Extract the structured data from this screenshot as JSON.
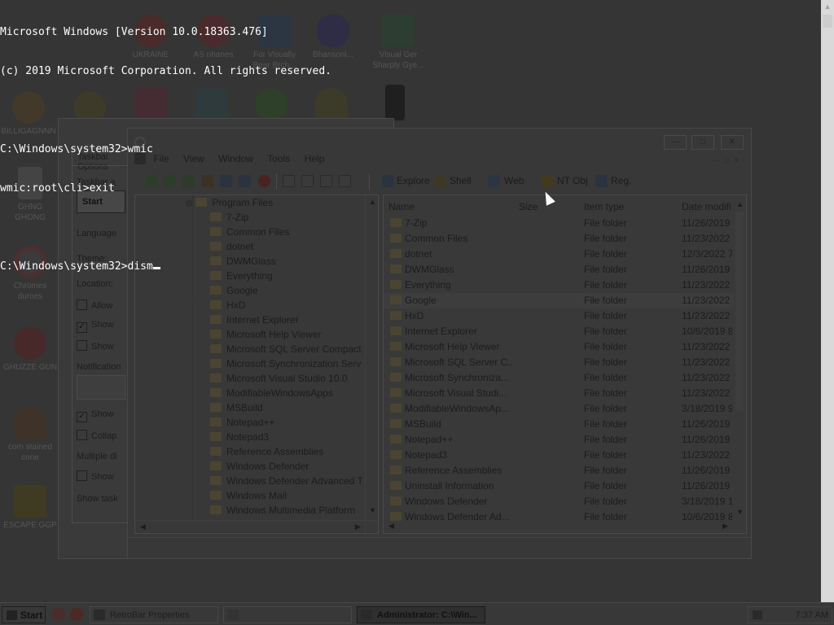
{
  "console": {
    "lines": [
      "Microsoft Windows [Version 10.0.18363.476]",
      "(c) 2019 Microsoft Corporation. All rights reserved.",
      "",
      "C:\\Windows\\system32>wmic",
      "wmic:root\\cli>exit",
      "",
      "C:\\Windows\\system32>dism"
    ]
  },
  "desktop": {
    "icons": [
      {
        "label": "UKRAINE"
      },
      {
        "label": "AS nhanes"
      },
      {
        "label": "For Visually Bear Brch..."
      },
      {
        "label": "Bhansonl..."
      },
      {
        "label": "Visual Ger Sharply Gye..."
      },
      {
        "label": "BILLIGAGNNN"
      },
      {
        "label": "GHNG GHONG"
      },
      {
        "label": "Chromes duroes"
      },
      {
        "label": "GHUZZE GUN"
      },
      {
        "label": "com stained cone"
      },
      {
        "label": "ESCAPE GGP"
      }
    ]
  },
  "properties_dialog": {
    "tab_label": "Taskbar Options",
    "start_preview_label": "Start",
    "rows": [
      "Taskbar a",
      "Language",
      "Theme:",
      "Location:",
      "Allow",
      "Show",
      "Show",
      "Notification",
      "Show",
      "Collap",
      "Multiple di",
      "Show",
      "Show task"
    ]
  },
  "explorer": {
    "menu": [
      "File",
      "View",
      "Window",
      "Tools",
      "Help"
    ],
    "toolbar_buttons": [
      "Explore",
      "Shell",
      "Web",
      "NT Obj",
      "Reg."
    ],
    "tree": {
      "root": "Program Files",
      "items": [
        "7-Zip",
        "Common Files",
        "dotnet",
        "DWMGlass",
        "Everything",
        "Google",
        "HxD",
        "Internet Explorer",
        "Microsoft Help Viewer",
        "Microsoft SQL Server Compact",
        "Microsoft Synchronization Serv",
        "Microsoft Visual Studio 10.0",
        "ModifiableWindowsApps",
        "MSBuild",
        "Notepad++",
        "Notepad3",
        "Reference Assemblies",
        "Windows Defender",
        "Windows Defender Advanced T",
        "Windows Mail",
        "Windows Multimedia Platform"
      ]
    },
    "columns": {
      "name": "Name",
      "size": "Size",
      "type": "Item type",
      "date": "Date modifi"
    },
    "files": [
      {
        "name": "7-Zip",
        "type": "File folder",
        "date": "11/26/2019"
      },
      {
        "name": "Common Files",
        "type": "File folder",
        "date": "11/23/2022"
      },
      {
        "name": "dotnet",
        "type": "File folder",
        "date": "12/3/2022 7"
      },
      {
        "name": "DWMGlass",
        "type": "File folder",
        "date": "11/26/2019"
      },
      {
        "name": "Everything",
        "type": "File folder",
        "date": "11/23/2022"
      },
      {
        "name": "Google",
        "type": "File folder",
        "date": "11/23/2022"
      },
      {
        "name": "HxD",
        "type": "File folder",
        "date": "11/23/2022"
      },
      {
        "name": "Internet Explorer",
        "type": "File folder",
        "date": "10/6/2019 8"
      },
      {
        "name": "Microsoft Help Viewer",
        "type": "File folder",
        "date": "11/23/2022"
      },
      {
        "name": "Microsoft SQL Server C...",
        "type": "File folder",
        "date": "11/23/2022"
      },
      {
        "name": "Microsoft Synchroniza...",
        "type": "File folder",
        "date": "11/23/2022"
      },
      {
        "name": "Microsoft Visual Studi...",
        "type": "File folder",
        "date": "11/23/2022"
      },
      {
        "name": "ModifiableWindowsAp...",
        "type": "File folder",
        "date": "3/18/2019 9"
      },
      {
        "name": "MSBuild",
        "type": "File folder",
        "date": "11/26/2019"
      },
      {
        "name": "Notepad++",
        "type": "File folder",
        "date": "11/26/2019"
      },
      {
        "name": "Notepad3",
        "type": "File folder",
        "date": "11/23/2022"
      },
      {
        "name": "Reference Assemblies",
        "type": "File folder",
        "date": "11/26/2019"
      },
      {
        "name": "Uninstall Information",
        "type": "File folder",
        "date": "11/26/2019"
      },
      {
        "name": "Windows Defender",
        "type": "File folder",
        "date": "3/18/2019 1"
      },
      {
        "name": "Windows Defender Ad...",
        "type": "File folder",
        "date": "10/6/2019 8"
      }
    ]
  },
  "taskbar": {
    "start_label": "Start",
    "buttons": [
      {
        "label": "RetroBar Properties"
      },
      {
        "label": ""
      },
      {
        "label": "Administrator: C:\\Win..."
      }
    ],
    "clock": "7:37 AM"
  },
  "colors": {
    "console_text": "#ffffff",
    "dim_overlay": "#353535",
    "taskbar": "#383838"
  }
}
